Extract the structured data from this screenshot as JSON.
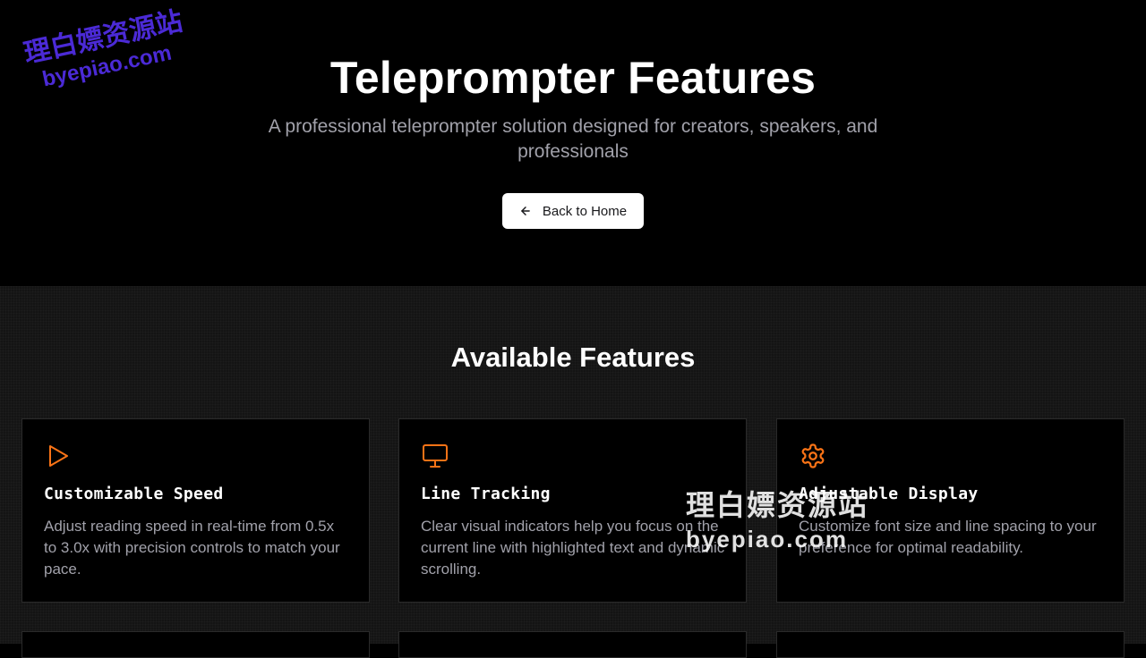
{
  "hero": {
    "title": "Teleprompter Features",
    "subtitle": "A professional teleprompter solution designed for creators, speakers, and professionals",
    "back_button_label": "Back to Home"
  },
  "features": {
    "section_title": "Available Features",
    "cards": [
      {
        "icon": "play-icon",
        "title": "Customizable Speed",
        "description": "Adjust reading speed in real-time from 0.5x to 3.0x with precision controls to match your pace."
      },
      {
        "icon": "monitor-icon",
        "title": "Line Tracking",
        "description": "Clear visual indicators help you focus on the current line with highlighted text and dynamic scrolling."
      },
      {
        "icon": "gear-icon",
        "title": "Adjustable Display",
        "description": "Customize font size and line spacing to your preference for optimal readability."
      }
    ]
  },
  "watermark": {
    "chinese": "理白嫖资源站",
    "domain": "byepiao.com"
  },
  "colors": {
    "accent": "#f97316",
    "background": "#000000",
    "section_background": "#141414",
    "muted_text": "#a1a1aa"
  }
}
